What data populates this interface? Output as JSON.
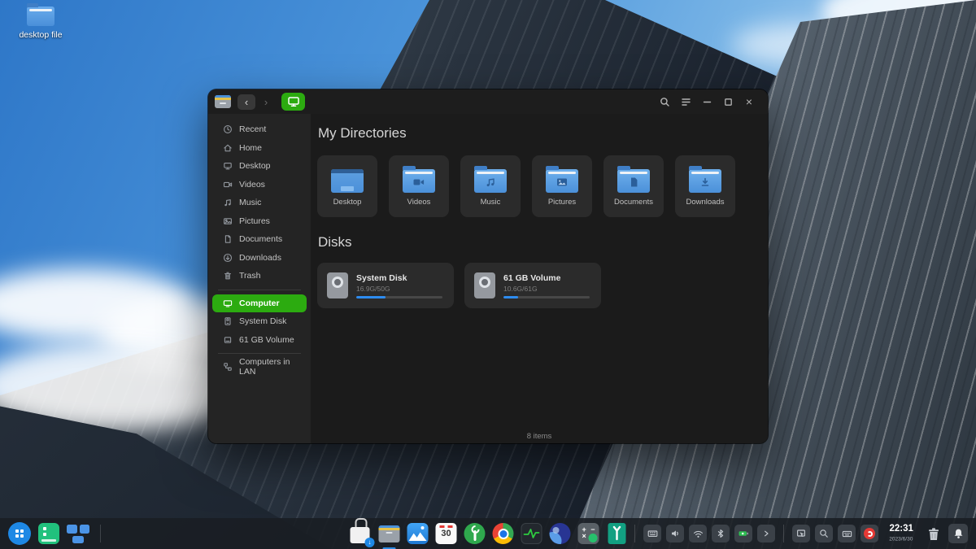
{
  "colors": {
    "accent_green": "#2cab10",
    "folder_blue": "#5b9bd8",
    "progress_blue": "#2d8cf0",
    "dock_bg": "rgba(26,30,36,0.9)"
  },
  "desktop": {
    "shortcut_label": "desktop file",
    "shortcut_icon": "folder-icon"
  },
  "window": {
    "titlebar": {
      "app_icon": "file-manager-app-icon",
      "back_icon": "chevron-left-icon",
      "forward_icon": "chevron-right-icon",
      "back_glyph": "‹",
      "forward_glyph": "›",
      "view_tab_icon": "computer-icon",
      "search_icon": "search-icon",
      "menu_icon": "menu-icon",
      "minimize_icon": "minimize-icon",
      "maximize_icon": "maximize-icon",
      "close_icon": "close-icon",
      "close_glyph": "×"
    },
    "sidebar": {
      "items": [
        {
          "label": "Recent",
          "icon": "recent-clock-icon",
          "selected": false
        },
        {
          "label": "Home",
          "icon": "home-icon",
          "selected": false
        },
        {
          "label": "Desktop",
          "icon": "desktop-monitor-icon",
          "selected": false
        },
        {
          "label": "Videos",
          "icon": "videos-icon",
          "selected": false
        },
        {
          "label": "Music",
          "icon": "music-icon",
          "selected": false
        },
        {
          "label": "Pictures",
          "icon": "pictures-icon",
          "selected": false
        },
        {
          "label": "Documents",
          "icon": "documents-icon",
          "selected": false
        },
        {
          "label": "Downloads",
          "icon": "downloads-icon",
          "selected": false
        },
        {
          "label": "Trash",
          "icon": "trash-icon",
          "selected": false
        },
        {
          "label": "Computer",
          "icon": "computer-icon",
          "selected": true
        },
        {
          "label": "System Disk",
          "icon": "system-disk-icon",
          "selected": false
        },
        {
          "label": "61 GB Volume",
          "icon": "volume-icon",
          "selected": false
        },
        {
          "label": "Computers in LAN",
          "icon": "network-icon",
          "selected": false
        }
      ]
    },
    "content": {
      "directories_title": "My Directories",
      "directories": [
        {
          "label": "Desktop",
          "icon": "desktop-folder-icon"
        },
        {
          "label": "Videos",
          "icon": "videos-folder-icon"
        },
        {
          "label": "Music",
          "icon": "music-folder-icon"
        },
        {
          "label": "Pictures",
          "icon": "pictures-folder-icon"
        },
        {
          "label": "Documents",
          "icon": "documents-folder-icon"
        },
        {
          "label": "Downloads",
          "icon": "downloads-folder-icon"
        }
      ],
      "disks_title": "Disks",
      "disks": [
        {
          "name": "System Disk",
          "usage": "16.9G/50G",
          "percent": 34,
          "icon": "hard-drive-icon"
        },
        {
          "name": "61 GB Volume",
          "usage": "10.6G/61G",
          "percent": 17,
          "icon": "hard-drive-icon"
        }
      ],
      "status": "8 items"
    }
  },
  "dock": {
    "left_items": [
      {
        "name": "launcher-icon"
      },
      {
        "name": "launchpad-icon"
      },
      {
        "name": "multitasking-view-icon"
      }
    ],
    "app_items": [
      {
        "name": "app-store-icon"
      },
      {
        "name": "file-manager-icon",
        "running": true
      },
      {
        "name": "image-viewer-icon"
      },
      {
        "name": "calendar-icon",
        "day": "30"
      },
      {
        "name": "control-center-icon"
      },
      {
        "name": "chrome-icon"
      },
      {
        "name": "system-monitor-icon"
      },
      {
        "name": "browser-icon"
      },
      {
        "name": "calculator-icon"
      },
      {
        "name": "toolbox-icon"
      }
    ],
    "tray_items": [
      {
        "name": "keyboard-icon"
      },
      {
        "name": "volume-icon"
      },
      {
        "name": "wifi-icon"
      },
      {
        "name": "bluetooth-icon"
      },
      {
        "name": "battery-icon"
      },
      {
        "name": "expand-chevron-icon"
      }
    ],
    "quick_items": [
      {
        "name": "screenshot-icon"
      },
      {
        "name": "search-icon"
      },
      {
        "name": "onboard-keyboard-icon"
      },
      {
        "name": "screen-recorder-icon"
      }
    ],
    "clock": {
      "time": "22:31",
      "date": "2023/6/30"
    },
    "trash": {
      "name": "trash-icon"
    },
    "notification": {
      "name": "notification-bell-icon"
    }
  }
}
